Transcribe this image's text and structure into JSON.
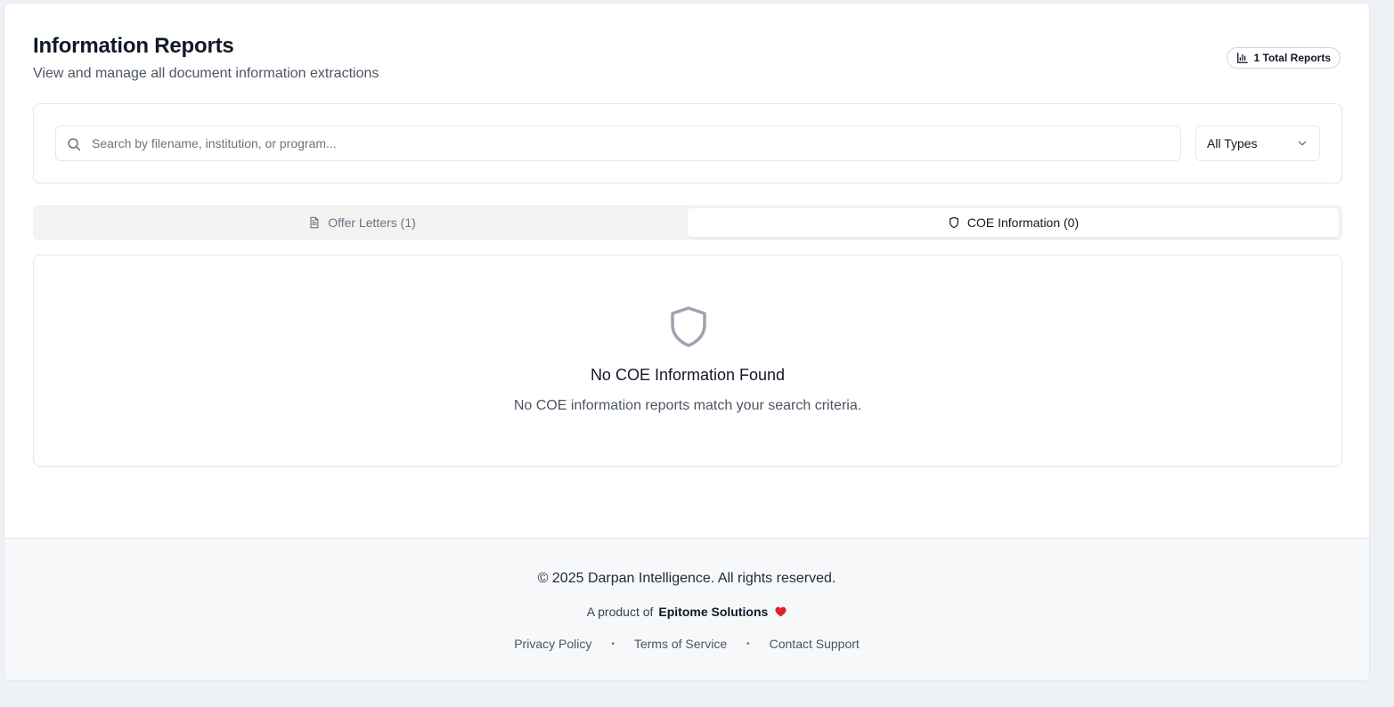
{
  "header": {
    "title": "Information Reports",
    "subtitle": "View and manage all document information extractions",
    "total_badge": "1 Total Reports"
  },
  "search": {
    "placeholder": "Search by filename, institution, or program...",
    "value": ""
  },
  "type_filter": {
    "selected": "All Types"
  },
  "tabs": [
    {
      "label": "Offer Letters (1)",
      "icon": "file-text-icon",
      "active": false
    },
    {
      "label": "COE Information (0)",
      "icon": "shield-icon",
      "active": true
    }
  ],
  "empty_state": {
    "icon": "shield-icon",
    "title": "No COE Information Found",
    "message": "No COE information reports match your search criteria."
  },
  "footer": {
    "copyright": "© 2025 Darpan Intelligence. All rights reserved.",
    "product_prefix": "A product of",
    "product_brand": "Epitome Solutions",
    "links": [
      "Privacy Policy",
      "Terms of Service",
      "Contact Support"
    ],
    "separator": "•"
  },
  "colors": {
    "heart": "#dc2626",
    "icon_gray": "#9ca3af",
    "tab_bg": "#f3f3f1"
  }
}
